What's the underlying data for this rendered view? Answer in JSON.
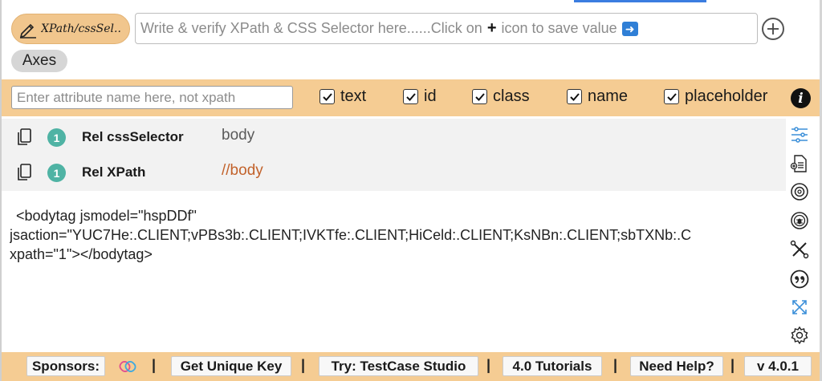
{
  "toolbar": {
    "mode_label": "XPath/cssSel..",
    "input_placeholder_before": "Write & verify XPath & CSS Selector here......Click on",
    "input_plus_glyph": "+",
    "input_placeholder_after": "icon to save value",
    "axes_label": "Axes"
  },
  "attributes": {
    "input_placeholder": "Enter attribute name here, not xpath",
    "checkboxes": [
      {
        "label": "text",
        "checked": true
      },
      {
        "label": "id",
        "checked": true
      },
      {
        "label": "class",
        "checked": true
      },
      {
        "label": "name",
        "checked": true
      },
      {
        "label": "placeholder",
        "checked": true
      }
    ],
    "info_glyph": "i"
  },
  "results": [
    {
      "count": "1",
      "label": "Rel cssSelector",
      "value": "body",
      "value_color": "#5a5a5a"
    },
    {
      "count": "1",
      "label": "Rel XPath",
      "value": "//body",
      "value_color": "#c2622b"
    }
  ],
  "output": {
    "lines": [
      "<bodytag jsmodel=\"hspDDf\"",
      "jsaction=\"YUC7He:.CLIENT;vPBs3b:.CLIENT;IVKTfe:.CLIENT;HiCeld:.CLIENT;KsNBn:.CLIENT;sbTXNb:.C",
      "xpath=\"1\"></bodytag>"
    ]
  },
  "side_icons": [
    "sliders-icon",
    "document-add-icon",
    "camera-shutter-icon",
    "bug-target-icon",
    "tools-icon",
    "quote-icon",
    "expand-icon",
    "settings-icon"
  ],
  "footer": {
    "sponsors_label": "Sponsors:",
    "separator": "|",
    "get_key_label": "Get Unique Key",
    "try_label": "Try: TestCase Studio",
    "tutorials_label": "4.0 Tutorials",
    "help_label": "Need Help?",
    "version_label": "v 4.0.1"
  },
  "colors": {
    "accent_orange": "#f5cc93",
    "badge_teal": "#4fb3a4",
    "xpath_value": "#c2622b",
    "icon_blue": "#3b8fd9"
  }
}
